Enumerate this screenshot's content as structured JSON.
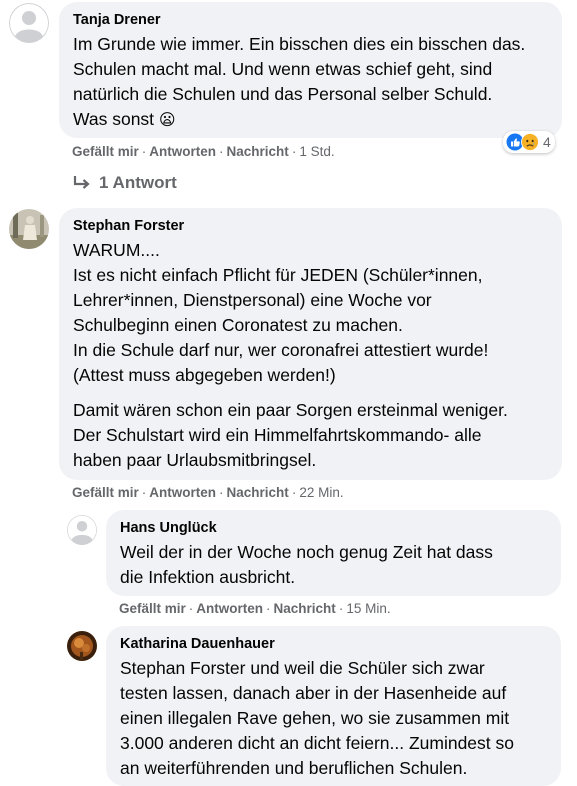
{
  "colors": {
    "bubble_bg": "#f0f2f5",
    "meta_text": "#65676b",
    "like_blue": "#1877f2",
    "sad_yellow": "#f7b125"
  },
  "comments": [
    {
      "author": "Tanja Drener",
      "text": "Im Grunde wie immer. Ein bisschen dies ein bisschen das.\nSchulen macht mal. Und wenn etwas schief geht, sind\nnatürlich die Schulen und das Personal selber Schuld.\nWas sonst",
      "emoji": "😦",
      "actions": {
        "like": "Gefällt mir",
        "reply": "Antworten",
        "message": "Nachricht",
        "time": "1 Std."
      },
      "reactions": {
        "icons": [
          "like-icon",
          "sad-icon"
        ],
        "count": "4"
      },
      "replies_link": "1 Antwort"
    },
    {
      "author": "Stephan Forster",
      "text": "WARUM....\nIst es nicht einfach Pflicht für JEDEN (Schüler*innen,\nLehrer*innen, Dienstpersonal) eine Woche vor\nSchulbeginn einen Coronatest zu machen.\nIn die Schule darf nur, wer coronafrei attestiert wurde!\n(Attest muss abgegeben werden!)",
      "text2": "Damit wären schon ein paar Sorgen ersteinmal weniger.\nDer Schulstart wird ein Himmelfahrtskommando- alle\nhaben paar Urlaubsmitbringsel.",
      "actions": {
        "like": "Gefällt mir",
        "reply": "Antworten",
        "message": "Nachricht",
        "time": "22 Min."
      }
    }
  ],
  "replies": [
    {
      "author": "Hans Unglück",
      "text": "Weil der in der Woche noch genug Zeit hat dass\ndie Infektion ausbricht.",
      "actions": {
        "like": "Gefällt mir",
        "reply": "Antworten",
        "message": "Nachricht",
        "time": "15 Min."
      }
    },
    {
      "author": "Katharina Dauenhauer",
      "text": "Stephan Forster und weil die Schüler sich zwar\ntesten lassen, danach aber in der Hasenheide auf\neinen illegalen Rave gehen, wo sie zusammen mit\n3.000 anderen dicht an dicht feiern... Zumindest so\nan weiterführenden und beruflichen Schulen."
    }
  ]
}
